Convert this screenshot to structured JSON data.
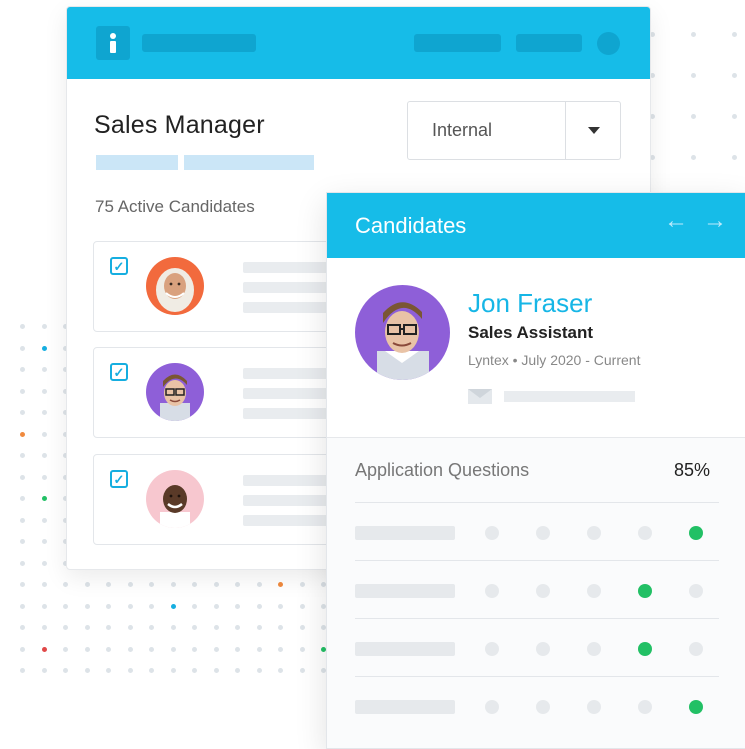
{
  "colors": {
    "brand": "#16bce8",
    "accent_green": "#22c065"
  },
  "job": {
    "title": "Sales Manager",
    "source_select": {
      "value": "Internal"
    },
    "active_candidates_label": "75 Active Candidates"
  },
  "candidate_list": [
    {
      "checked": true,
      "avatar": "avatar-woman-hijab"
    },
    {
      "checked": true,
      "avatar": "avatar-man-glasses"
    },
    {
      "checked": true,
      "avatar": "avatar-man-smiling"
    }
  ],
  "panel": {
    "title": "Candidates",
    "prev_icon": "arrow-left-icon",
    "next_icon": "arrow-right-icon",
    "profile": {
      "name": "Jon Fraser",
      "role": "Sales Assistant",
      "meta": "Lyntex • July 2020 - Current",
      "email_icon": "mail-icon"
    },
    "questions": {
      "title": "Application Questions",
      "score": "85%",
      "rows": [
        {
          "selected": 5
        },
        {
          "selected": 4
        },
        {
          "selected": 4
        },
        {
          "selected": 5
        }
      ]
    }
  }
}
